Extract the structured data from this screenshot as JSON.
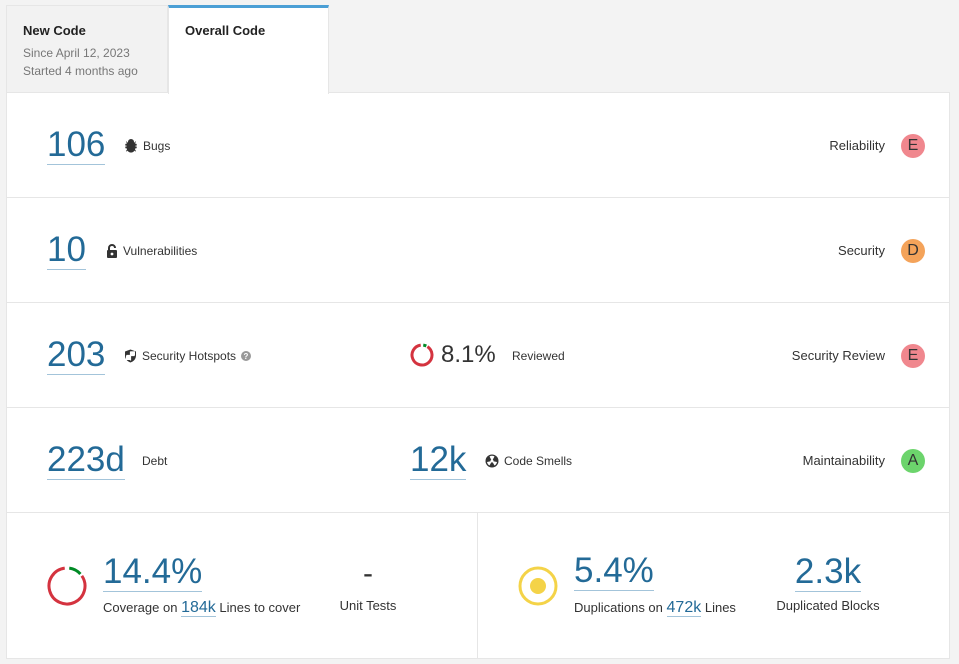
{
  "tabs": [
    {
      "title": "New Code",
      "lines": [
        "Since April 12, 2023",
        "Started 4 months ago"
      ],
      "active": false
    },
    {
      "title": "Overall Code",
      "lines": [],
      "active": true
    }
  ],
  "rows": {
    "bugs": {
      "value": "106",
      "label": "Bugs",
      "icon": "bug-icon",
      "rating_label": "Reliability",
      "rating": "E",
      "rating_color": "#f0878e"
    },
    "vulnerabilities": {
      "value": "10",
      "label": "Vulnerabilities",
      "icon": "lock-icon",
      "rating_label": "Security",
      "rating": "D",
      "rating_color": "#f4a35a"
    },
    "hotspots": {
      "value": "203",
      "label": "Security Hotspots",
      "icon": "shield-icon",
      "help_icon": "question-circle-icon",
      "reviewed_percent": "8.1%",
      "reviewed_fraction": 0.081,
      "reviewed_label": "Reviewed",
      "rating_label": "Security Review",
      "rating": "E",
      "rating_color": "#f0878e"
    },
    "maintainability": {
      "debt_value": "223d",
      "debt_label": "Debt",
      "smells_value": "12k",
      "smells_label": "Code Smells",
      "icon": "code-smell-icon",
      "rating_label": "Maintainability",
      "rating": "A",
      "rating_color": "#6cd46c"
    }
  },
  "coverage": {
    "value": "14.4%",
    "fraction": 0.144,
    "prefix": "Coverage on",
    "lines": "184k",
    "suffix": "Lines to cover",
    "unit_tests_value": "-",
    "unit_tests_label": "Unit Tests"
  },
  "duplications": {
    "value": "5.4%",
    "prefix": "Duplications on",
    "lines": "472k",
    "suffix": "Lines",
    "blocks_value": "2.3k",
    "blocks_label": "Duplicated Blocks"
  },
  "colors": {
    "accent": "#4b9fd5",
    "link": "#236a97",
    "good": "#008a25",
    "bad": "#d4333f",
    "dup": "#f4d348"
  }
}
